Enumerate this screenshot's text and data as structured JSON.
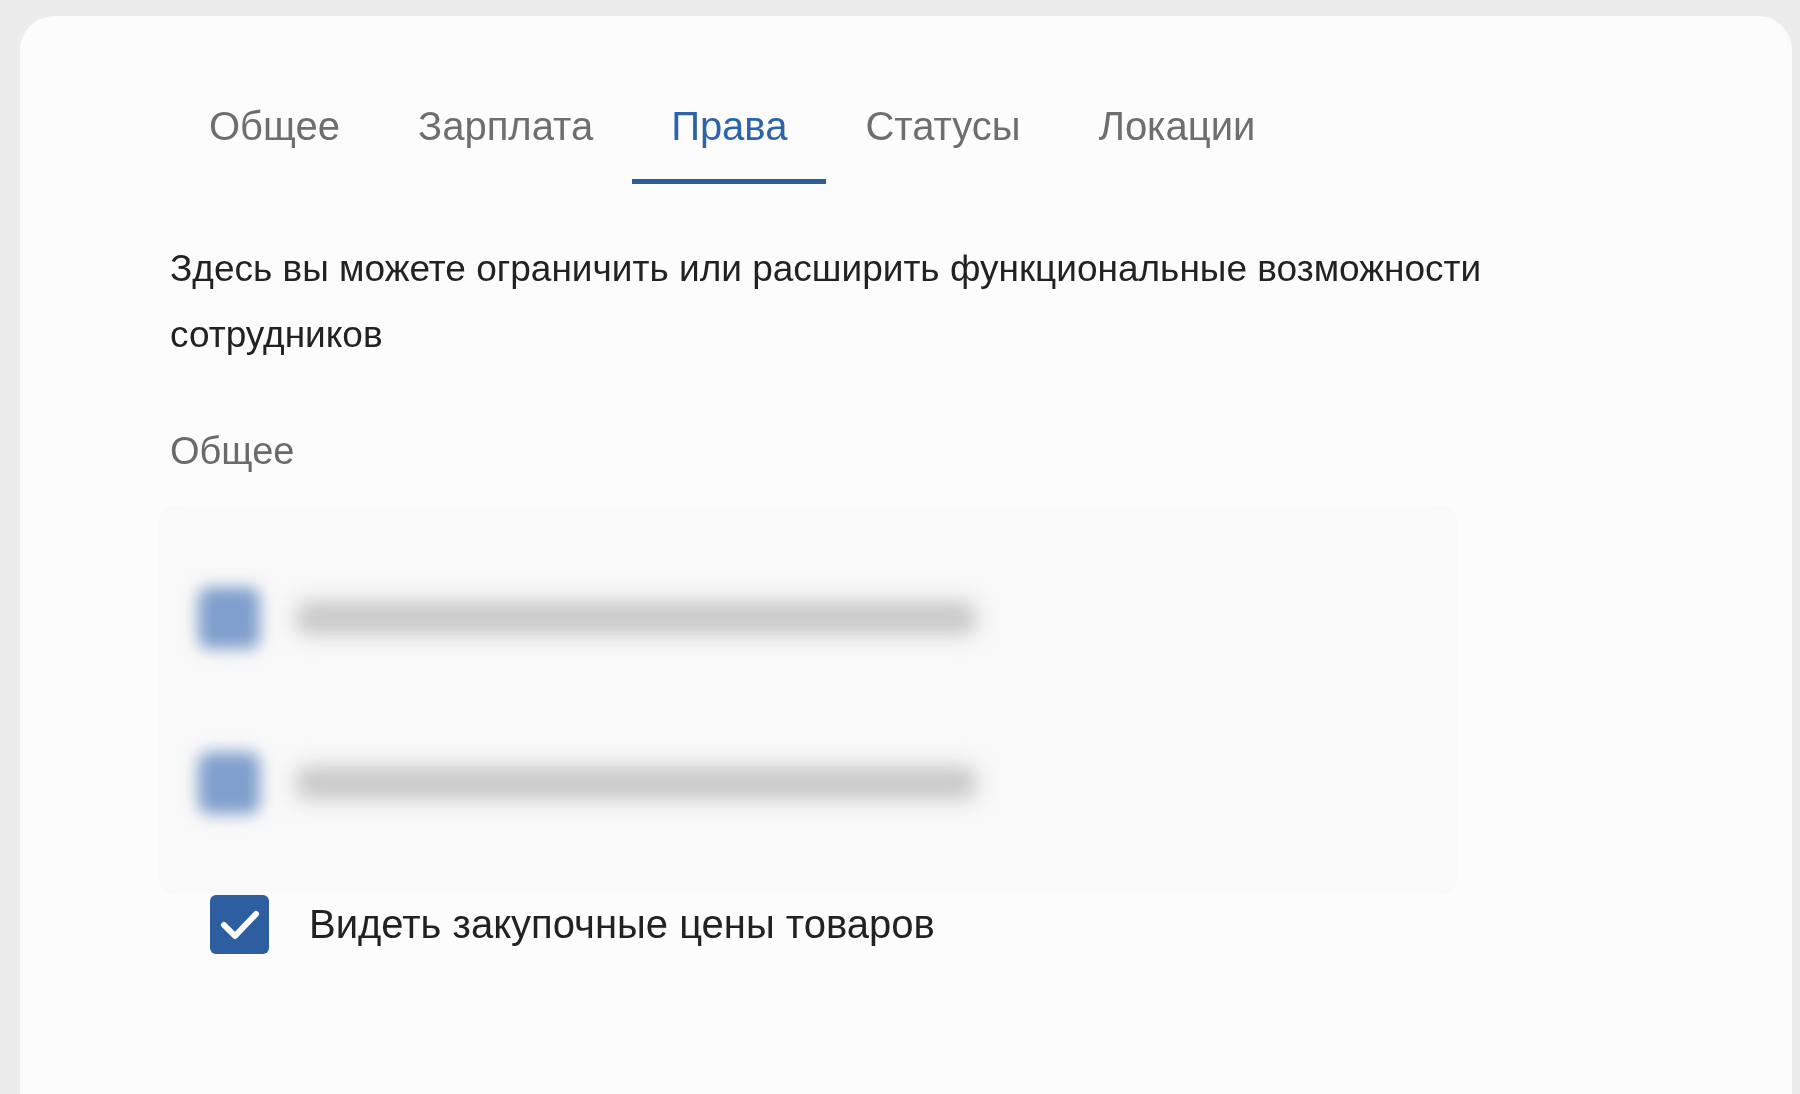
{
  "tabs": [
    {
      "label": "Общее",
      "selected": false
    },
    {
      "label": "Зарплата",
      "selected": false
    },
    {
      "label": "Права",
      "selected": true
    },
    {
      "label": "Статусы",
      "selected": false
    },
    {
      "label": "Локации",
      "selected": false
    }
  ],
  "description": "Здесь вы можете ограничить или расширить функциональные возможности сотрудников",
  "section": {
    "title": "Общее",
    "hidden_items": [
      {
        "checked": true
      },
      {
        "checked": true
      }
    ],
    "items": [
      {
        "label": "Видеть закупочные цены товаров",
        "checked": true
      }
    ]
  }
}
